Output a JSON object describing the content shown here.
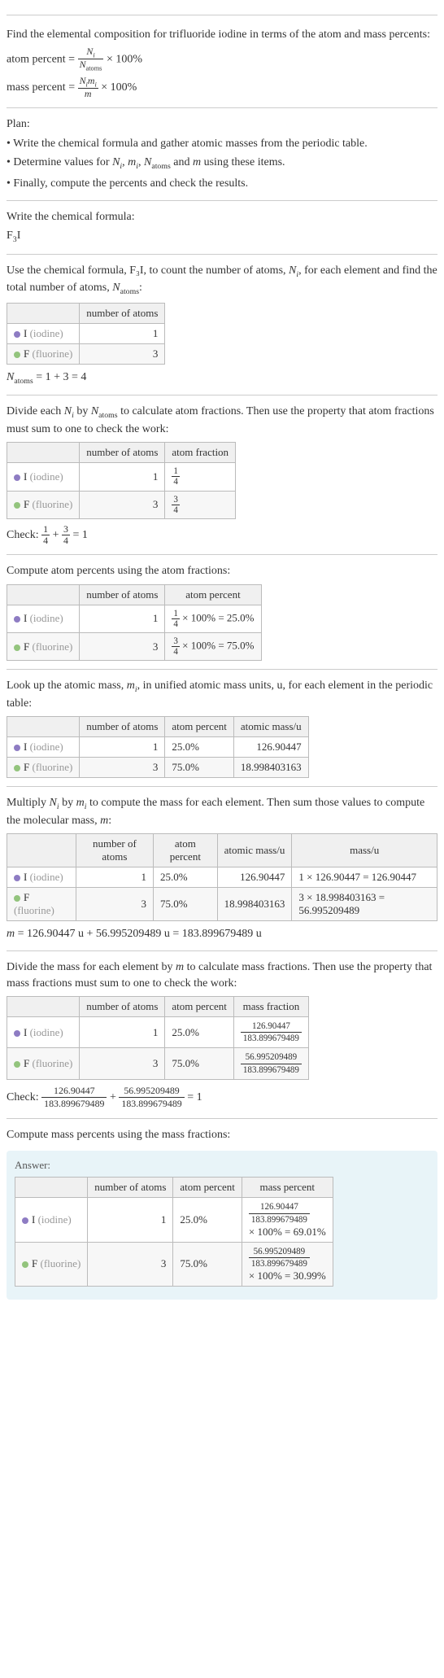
{
  "intro": {
    "line1": "Find the elemental composition for trifluoride iodine in terms of the atom and mass percents:",
    "atom_percent_label": "atom percent = ",
    "atom_percent_frac_num": "N_i",
    "atom_percent_frac_den": "N_atoms",
    "times100": " × 100%",
    "mass_percent_label": "mass percent = ",
    "mass_percent_frac_num": "N_i m_i",
    "mass_percent_frac_den": "m"
  },
  "plan": {
    "heading": "Plan:",
    "b1": "• Write the chemical formula and gather atomic masses from the periodic table.",
    "b2_pre": "• Determine values for ",
    "b2_vars": "N_i, m_i, N_atoms and m",
    "b2_post": " using these items.",
    "b3": "• Finally, compute the percents and check the results."
  },
  "formula_section": {
    "heading": "Write the chemical formula:",
    "formula": "F₃I"
  },
  "count_section": {
    "text_pre": "Use the chemical formula, F₃I, to count the number of atoms, ",
    "text_mid": ", for each element and find the total number of atoms, ",
    "text_post": ":",
    "th_atoms": "number of atoms",
    "row_i_label": "I ",
    "row_i_gray": "(iodine)",
    "row_i_atoms": "1",
    "row_f_label": "F ",
    "row_f_gray": "(fluorine)",
    "row_f_atoms": "3",
    "total_line_pre": "N",
    "total_line": " = 1 + 3 = 4"
  },
  "atomfrac_section": {
    "text": "Divide each N_i by N_atoms to calculate atom fractions. Then use the property that atom fractions must sum to one to check the work:",
    "th_atoms": "number of atoms",
    "th_frac": "atom fraction",
    "row_i_atoms": "1",
    "row_i_frac_num": "1",
    "row_i_frac_den": "4",
    "row_f_atoms": "3",
    "row_f_frac_num": "3",
    "row_f_frac_den": "4",
    "check_label": "Check: ",
    "check_eq": " = 1"
  },
  "atompct_section": {
    "text": "Compute atom percents using the atom fractions:",
    "th_atoms": "number of atoms",
    "th_pct": "atom percent",
    "row_i_atoms": "1",
    "row_i_pct": " × 100% = 25.0%",
    "row_f_atoms": "3",
    "row_f_pct": " × 100% = 75.0%"
  },
  "mass_lookup_section": {
    "text_pre": "Look up the atomic mass, ",
    "text_post": ", in unified atomic mass units, u, for each element in the periodic table:",
    "th_atoms": "number of atoms",
    "th_pct": "atom percent",
    "th_mass": "atomic mass/u",
    "row_i_atoms": "1",
    "row_i_pct": "25.0%",
    "row_i_mass": "126.90447",
    "row_f_atoms": "3",
    "row_f_pct": "75.0%",
    "row_f_mass": "18.998403163"
  },
  "molmass_section": {
    "text_pre": "Multiply ",
    "text_mid": " by ",
    "text_post": " to compute the mass for each element. Then sum those values to compute the molecular mass, ",
    "text_end": ":",
    "th_atoms": "number of atoms",
    "th_pct": "atom percent",
    "th_amass": "atomic mass/u",
    "th_mass": "mass/u",
    "row_i_atoms": "1",
    "row_i_pct": "25.0%",
    "row_i_amass": "126.90447",
    "row_i_mass": "1 × 126.90447 = 126.90447",
    "row_f_atoms": "3",
    "row_f_pct": "75.0%",
    "row_f_amass": "18.998403163",
    "row_f_mass": "3 × 18.998403163 = 56.995209489",
    "total": " = 126.90447 u + 56.995209489 u = 183.899679489 u"
  },
  "massfrac_section": {
    "text": "Divide the mass for each element by m to calculate mass fractions. Then use the property that mass fractions must sum to one to check the work:",
    "th_atoms": "number of atoms",
    "th_pct": "atom percent",
    "th_mfrac": "mass fraction",
    "row_i_atoms": "1",
    "row_i_pct": "25.0%",
    "row_i_frac_num": "126.90447",
    "row_i_frac_den": "183.899679489",
    "row_f_atoms": "3",
    "row_f_pct": "75.0%",
    "row_f_frac_num": "56.995209489",
    "row_f_frac_den": "183.899679489",
    "check_label": "Check: ",
    "check_eq": " = 1"
  },
  "final_section": {
    "text": "Compute mass percents using the mass fractions:",
    "answer_label": "Answer:",
    "th_atoms": "number of atoms",
    "th_apct": "atom percent",
    "th_mpct": "mass percent",
    "row_i_atoms": "1",
    "row_i_apct": "25.0%",
    "row_i_frac_num": "126.90447",
    "row_i_frac_den": "183.899679489",
    "row_i_mpct_post": " × 100% = 69.01%",
    "row_f_atoms": "3",
    "row_f_apct": "75.0%",
    "row_f_frac_num": "56.995209489",
    "row_f_frac_den": "183.899679489",
    "row_f_mpct_post": " × 100% = 30.99%"
  }
}
